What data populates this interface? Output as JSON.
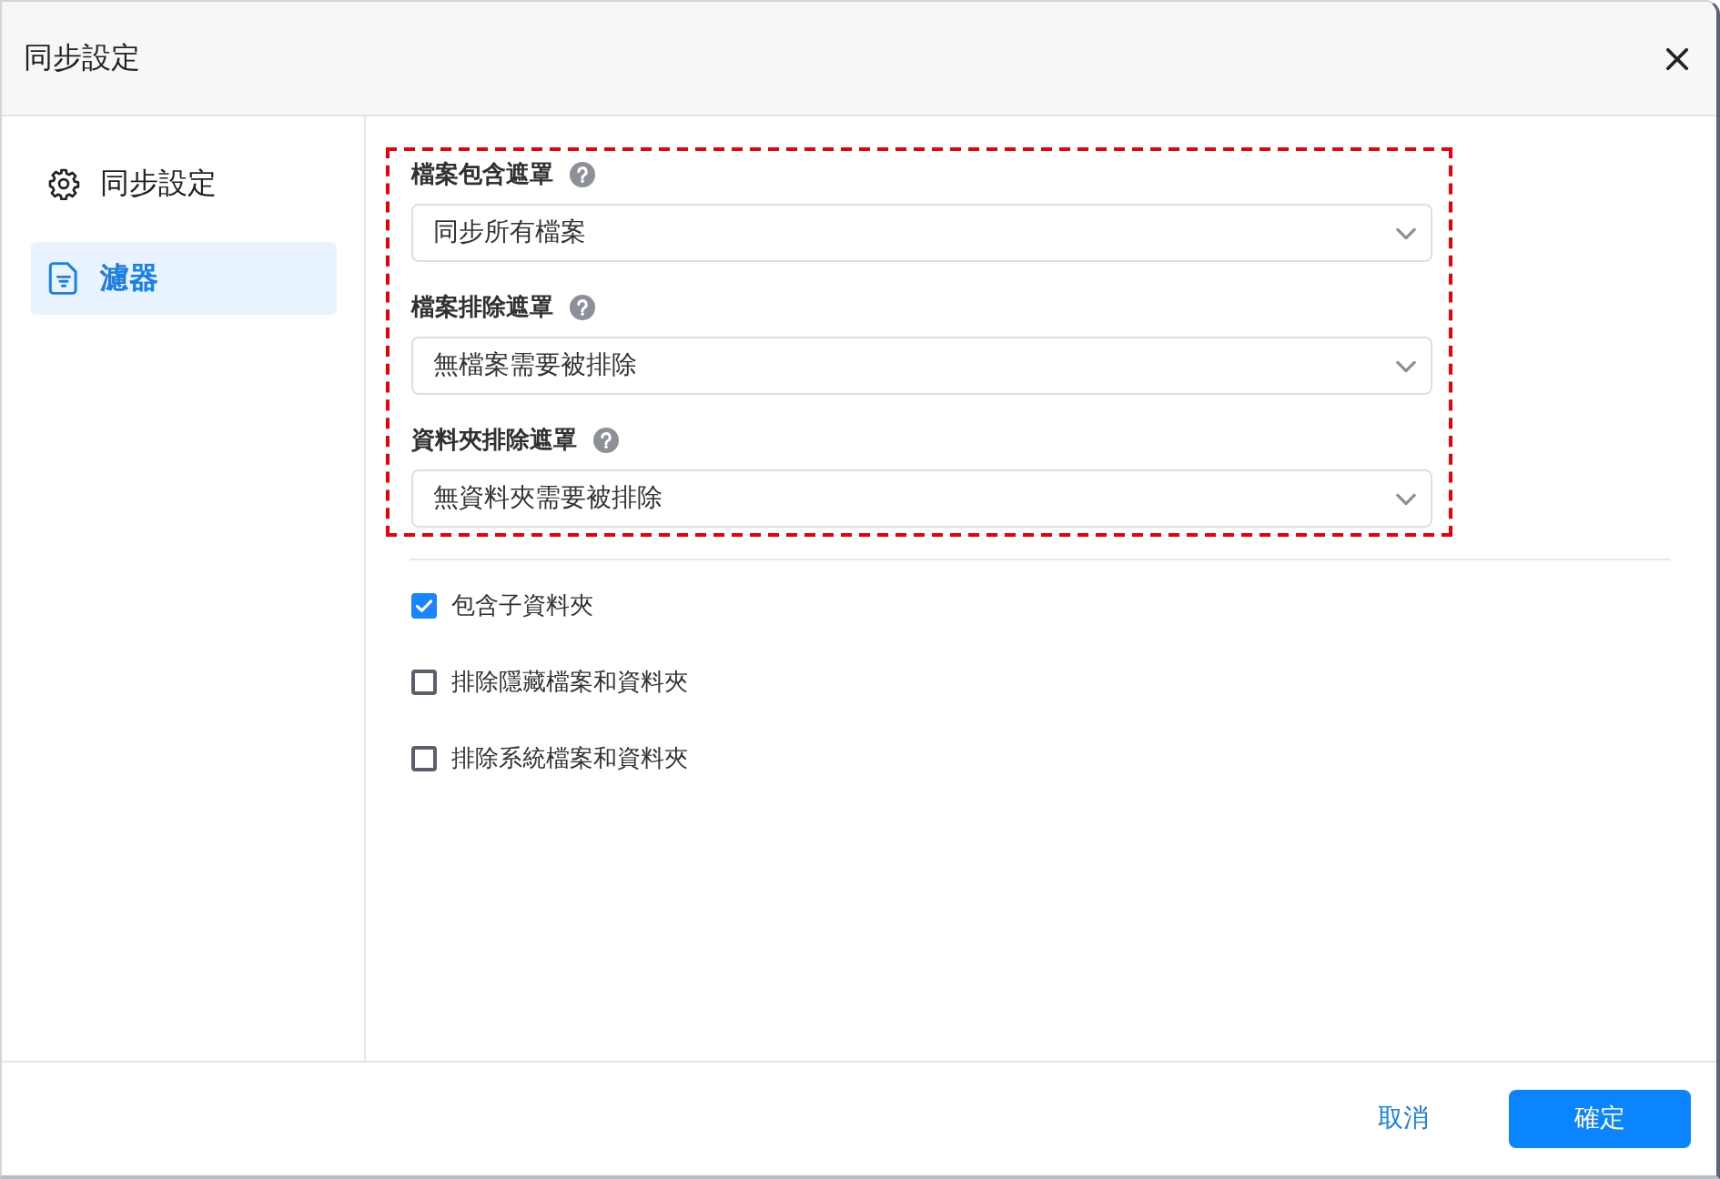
{
  "dialog": {
    "title": "同步設定"
  },
  "sidebar": {
    "items": [
      {
        "label": "同步設定",
        "selected": false
      },
      {
        "label": "濾器",
        "selected": true
      }
    ]
  },
  "filters": [
    {
      "label": "檔案包含遮罩",
      "value": "同步所有檔案"
    },
    {
      "label": "檔案排除遮罩",
      "value": "無檔案需要被排除"
    },
    {
      "label": "資料夾排除遮罩",
      "value": "無資料夾需要被排除"
    }
  ],
  "options": [
    {
      "label": "包含子資料夾",
      "checked": true
    },
    {
      "label": "排除隱藏檔案和資料夾",
      "checked": false
    },
    {
      "label": "排除系統檔案和資料夾",
      "checked": false
    }
  ],
  "buttons": [
    {
      "label": "取消",
      "kind": "text"
    },
    {
      "label": "確定",
      "kind": "primary"
    }
  ]
}
